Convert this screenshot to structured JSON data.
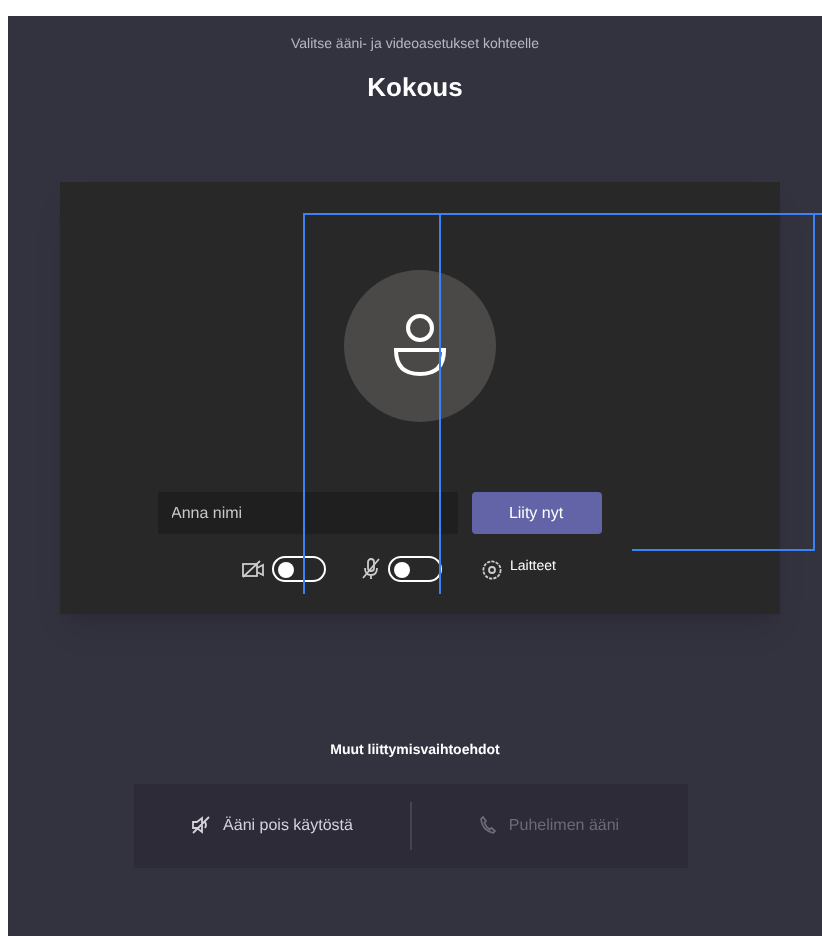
{
  "header": {
    "subtitle": "Valitse ääni- ja videoasetukset kohteelle",
    "title": "Kokous"
  },
  "preview": {
    "name_field": {
      "placeholder": "Anna nimi"
    },
    "join_button": "Liity nyt",
    "controls": [
      {
        "kind": "camera",
        "on": false
      },
      {
        "kind": "mic",
        "on": false
      }
    ],
    "devices": "Laitteet"
  },
  "other_options": {
    "title": "Muut liittymisvaihtoehdot",
    "options": [
      {
        "kind": "audio-off",
        "label": "Ääni pois käytöstä",
        "disabled": false
      },
      {
        "kind": "phone",
        "label": "Puhelimen ääni",
        "disabled": true
      }
    ]
  }
}
